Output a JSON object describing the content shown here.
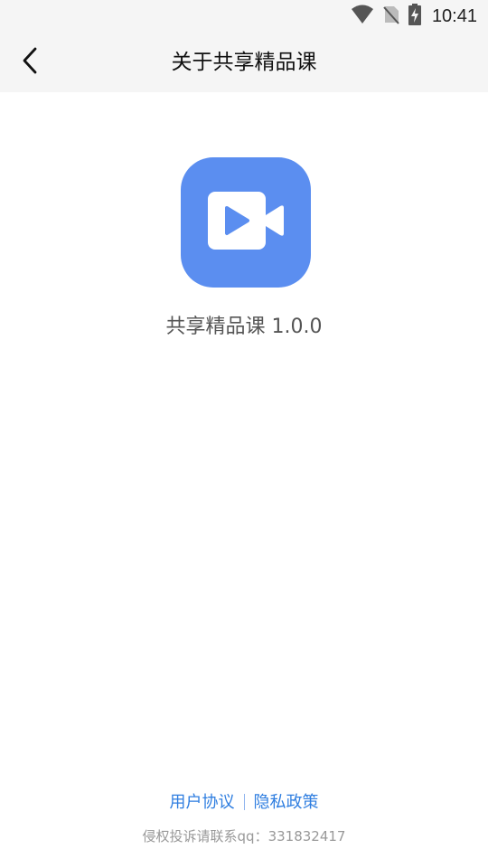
{
  "status_bar": {
    "time": "10:41",
    "icons": [
      "wifi-icon",
      "no-sim-icon",
      "battery-charging-icon"
    ]
  },
  "app_bar": {
    "back_icon": "chevron-left-icon",
    "title": "关于共享精品课"
  },
  "about": {
    "logo_icon": "video-camera-icon",
    "logo_color": "#5b8ef0",
    "app_name_version": "共享精品课 1.0.0"
  },
  "footer": {
    "user_agreement": "用户协议",
    "privacy_policy": "隐私政策",
    "complaint_text": "侵权投诉请联系qq：331832417",
    "link_color": "#2f7ee0"
  }
}
